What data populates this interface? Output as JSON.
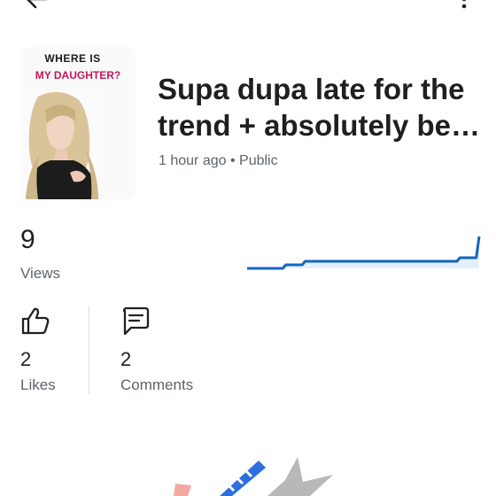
{
  "header": {
    "back_icon": "arrow-left-icon",
    "more_icon": "more-vertical-icon"
  },
  "thumbnail": {
    "caption_line1": "WHERE IS",
    "caption_line2": "MY DAUGHTER?"
  },
  "video": {
    "title": "Supa dupa late for the trend + absolutely be…",
    "time": "1 hour ago",
    "separator": "•",
    "visibility": "Public"
  },
  "views": {
    "count": "9",
    "label": "Views"
  },
  "likes": {
    "icon": "thumbs-up-icon",
    "count": "2",
    "label": "Likes"
  },
  "comments": {
    "icon": "comment-icon",
    "count": "2",
    "label": "Comments"
  },
  "colors": {
    "chart_line": "#1565c0",
    "chart_fill": "#e3f0fb",
    "caption_accent": "#c2185b"
  },
  "chart_data": {
    "type": "area",
    "x": [
      0,
      1,
      2,
      3,
      4,
      5,
      6,
      7,
      8,
      9,
      10,
      11,
      12
    ],
    "values": [
      0,
      0,
      1,
      2,
      2,
      2,
      2,
      2,
      2,
      2,
      2,
      3,
      9
    ],
    "title": "",
    "xlabel": "",
    "ylabel": ""
  }
}
